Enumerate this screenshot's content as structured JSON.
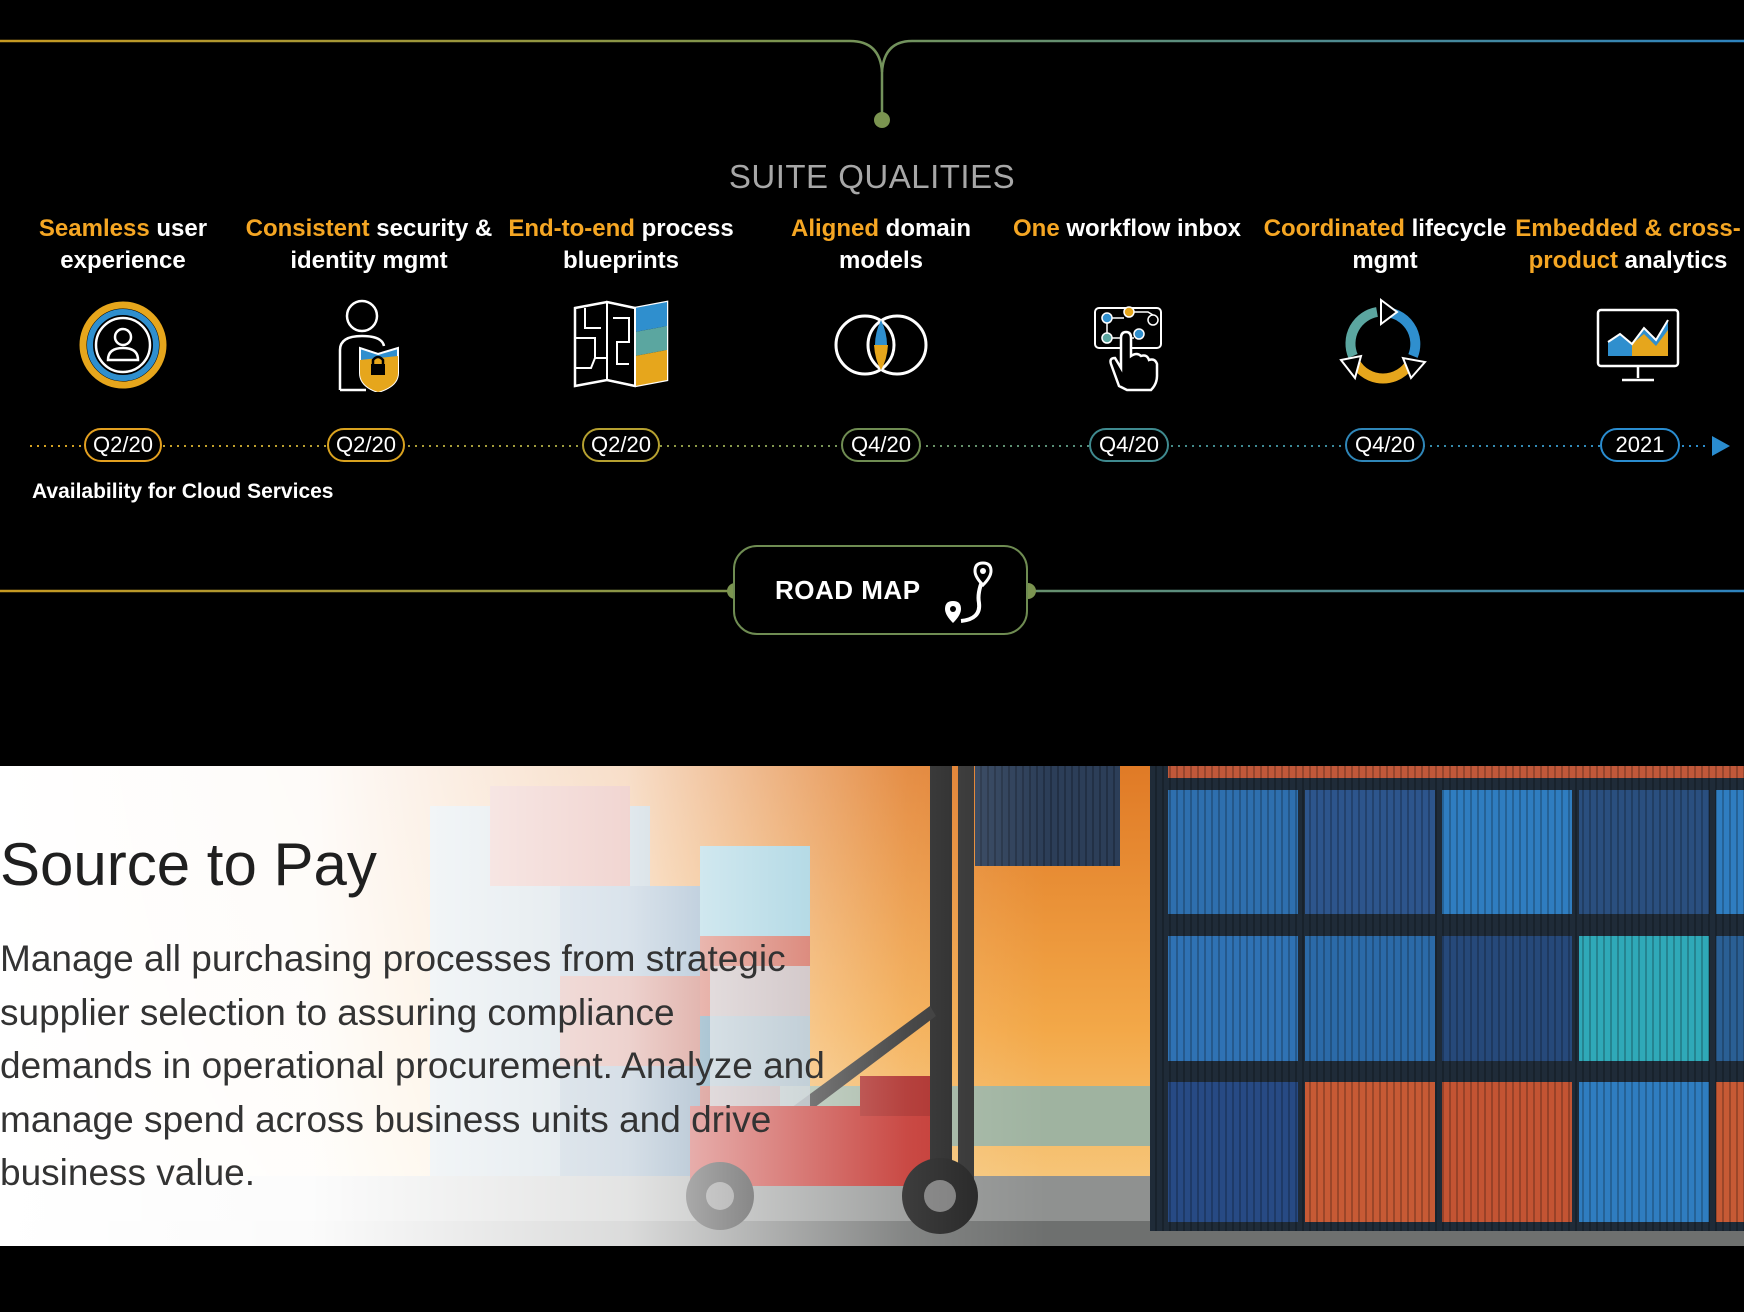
{
  "roadmap": {
    "section_title": "SUITE QUALITIES",
    "qualities": [
      {
        "highlight": "Seamless",
        "rest": " user experience",
        "icon": "user-circle-icon",
        "date": "Q2/20"
      },
      {
        "highlight": "Consistent",
        "rest": " security & identity mgmt",
        "icon": "user-shield-icon",
        "date": "Q2/20"
      },
      {
        "highlight": "End-to-end",
        "rest": " process blueprints",
        "icon": "map-icon",
        "date": "Q2/20"
      },
      {
        "highlight": "Aligned",
        "rest": " domain models",
        "icon": "overlapping-circles-icon",
        "date": "Q4/20"
      },
      {
        "highlight": "One",
        "rest": " workflow inbox",
        "icon": "workflow-touch-icon",
        "date": "Q4/20"
      },
      {
        "highlight": "Coordinated",
        "rest": " lifecycle mgmt",
        "icon": "lifecycle-arrows-icon",
        "date": "Q4/20"
      },
      {
        "highlight": "Embedded & cross-product",
        "rest": " analytics",
        "icon": "analytics-monitor-icon",
        "date": "2021"
      }
    ],
    "availability_label": "Availability for Cloud Services",
    "road_map_label": "ROAD MAP",
    "road_map_icon": "route-pin-icon"
  },
  "source_to_pay": {
    "title": "Source to Pay",
    "description": "Manage all purchasing processes from strategic supplier selection to assuring compliance demands in operational procurement. Analyze and manage spend across business units and drive business value.",
    "image": "shipping-containers-forklift-photo"
  },
  "colors": {
    "background": "#000000",
    "highlight_gold": "#f5a623",
    "title_gray": "#a7a7a7",
    "pill_gold": "#e3a020",
    "pill_teal": "#3f8a8f",
    "pill_blue": "#2f8fce",
    "road_map_green": "#6f8c52"
  }
}
